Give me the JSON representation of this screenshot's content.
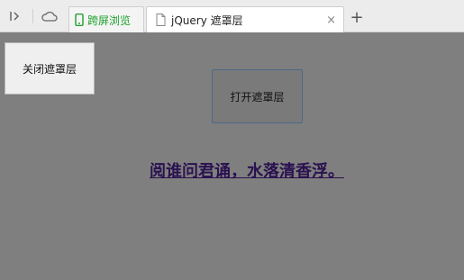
{
  "browser": {
    "tabs": [
      {
        "label": "跨屏浏览",
        "icon": "phone-icon",
        "color": "#1aa02a"
      },
      {
        "label": "jQuery 遮罩层",
        "icon": "page-icon",
        "active": true
      }
    ],
    "close_glyph": "×",
    "new_tab_glyph": "+"
  },
  "page": {
    "close_mask_label": "关闭遮罩层",
    "open_mask_label": "打开遮罩层",
    "poem_link": "阅谁问君诵，水落清香浮。",
    "overlay_color": "#7f7f7f"
  }
}
